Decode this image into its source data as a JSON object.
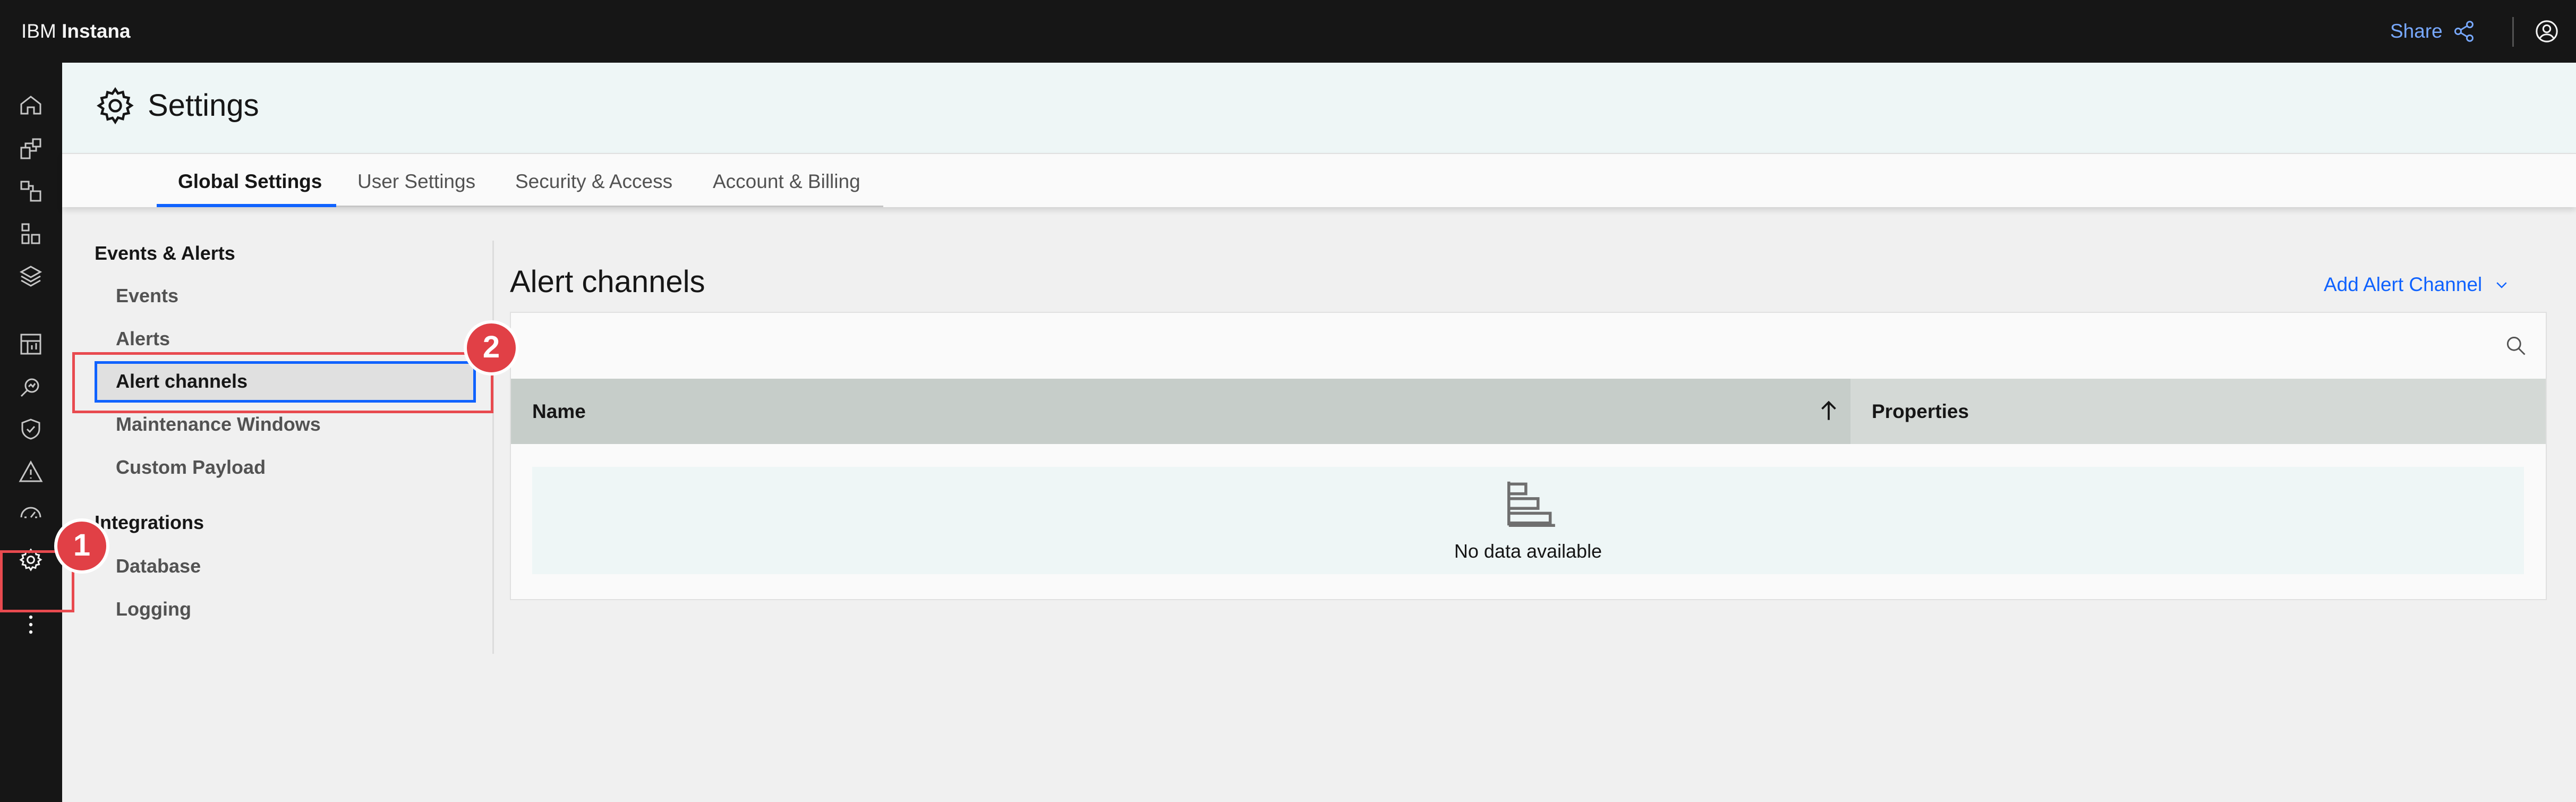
{
  "header": {
    "brand_prefix": "IBM",
    "brand_name": "Instana",
    "share_label": "Share"
  },
  "rail": {
    "icons": [
      "home-icon",
      "application-icon",
      "infrastructure-icon",
      "platforms-icon",
      "stack-layers-icon",
      "dashboards-icon",
      "analytics-icon",
      "security-shield-icon",
      "alert-warning-icon",
      "synthetic-monitoring-icon",
      "settings-gear-icon",
      "more-overflow-icon"
    ]
  },
  "page": {
    "title": "Settings",
    "tabs": [
      {
        "label": "Global Settings",
        "active": true
      },
      {
        "label": "User Settings"
      },
      {
        "label": "Security & Access"
      },
      {
        "label": "Account & Billing"
      }
    ]
  },
  "nav": {
    "groups": [
      {
        "label": "Events & Alerts",
        "items": [
          {
            "label": "Events"
          },
          {
            "label": "Alerts"
          },
          {
            "label": "Alert channels",
            "active": true
          },
          {
            "label": "Maintenance Windows"
          },
          {
            "label": "Custom Payload"
          }
        ]
      },
      {
        "label": "Integrations",
        "items": [
          {
            "label": "Database"
          },
          {
            "label": "Logging"
          }
        ]
      }
    ]
  },
  "main": {
    "title": "Alert channels",
    "add_button": "Add Alert Channel",
    "table": {
      "columns": [
        "Name",
        "Properties"
      ],
      "sort": "ascending",
      "empty_text": "No data available"
    }
  },
  "annotations": [
    {
      "number": "1",
      "color": "#e14046"
    },
    {
      "number": "2",
      "color": "#e14046"
    }
  ]
}
